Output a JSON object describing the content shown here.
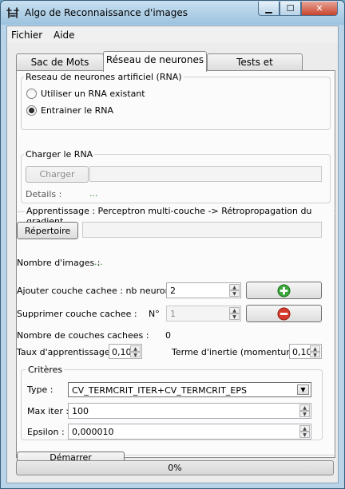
{
  "window": {
    "title": "Algo de Reconnaissance d'images"
  },
  "menu": {
    "items": [
      "Fichier",
      "Aide"
    ]
  },
  "tabs": [
    "Sac de Mots visuels",
    "Réseau de neurones",
    "Tests et Applications"
  ],
  "rna_group": {
    "title": "Reseau de neurones artificiel (RNA)",
    "option_existing": "Utiliser un RNA existant",
    "option_train": "Entrainer le RNA",
    "selected": "train"
  },
  "charger_group": {
    "title": "Charger le RNA",
    "button": "Charger",
    "path_value": "",
    "details_label": "Details :",
    "details_value": "..."
  },
  "apprentissage_group": {
    "title": "Apprentissage : Perceptron multi-couche -> Rétropropagation du gradient",
    "repertoire_button": "Répertoire",
    "path_value": "",
    "nb_images_label": "Nombre d'images :",
    "nb_images_value": "...",
    "add_layer_label": "Ajouter couche cachee : nb neurones",
    "add_layer_value": "2",
    "remove_layer_label": "Supprimer couche cachee :",
    "remove_layer_n_label": "N°",
    "remove_layer_value": "1",
    "nb_layers_label": "Nombre de couches cachees :",
    "nb_layers_value": "0",
    "learning_rate_label": "Taux d'apprentissage :",
    "learning_rate_value": "0,10",
    "momentum_label": "Terme d'inertie (momentum) :",
    "momentum_value": "0,10"
  },
  "criteres_group": {
    "title": "Critères",
    "type_label": "Type :",
    "type_value": "CV_TERMCRIT_ITER+CV_TERMCRIT_EPS",
    "max_iter_label": "Max iter :",
    "max_iter_value": "100",
    "epsilon_label": "Epsilon :",
    "epsilon_value": "0,000010"
  },
  "start_button": "Démarrer l'apprentissage !",
  "progress": {
    "text": "0%",
    "value": 0
  }
}
